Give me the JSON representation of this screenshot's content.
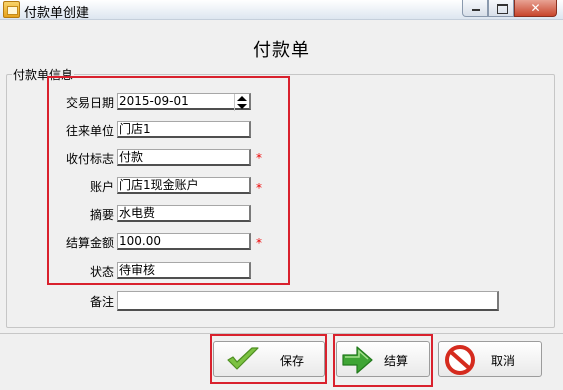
{
  "window": {
    "title": "付款单创建",
    "icons": {
      "app": "app-icon",
      "minimize": "minimize-icon",
      "maximize": "maximize-icon",
      "close": "close-icon"
    }
  },
  "form": {
    "title": "付款单",
    "group_label": "付款单信息"
  },
  "fields": {
    "trade_date": {
      "label": "交易日期",
      "value": "2015-09-01"
    },
    "partner": {
      "label": "往来单位",
      "value": "门店1"
    },
    "pay_flag": {
      "label": "收付标志",
      "value": "付款"
    },
    "account": {
      "label": "账户",
      "value": "门店1现金账户"
    },
    "summary": {
      "label": "摘要",
      "value": "水电费"
    },
    "amount": {
      "label": "结算金额",
      "value": "100.00"
    },
    "status": {
      "label": "状态",
      "value": "待审核"
    },
    "remark": {
      "label": "备注",
      "value": ""
    }
  },
  "required_mark": "*",
  "buttons": {
    "save": {
      "label": "保存",
      "icon": "checkmark-icon"
    },
    "settle": {
      "label": "结算",
      "icon": "arrow-right-icon"
    },
    "cancel": {
      "label": "取消",
      "icon": "no-entry-icon"
    }
  },
  "colors": {
    "highlight": "#d9212d",
    "required": "#e00000",
    "check_green": "#7cc242",
    "arrow_green": "#3fa535",
    "cancel_red": "#d52b1e"
  }
}
